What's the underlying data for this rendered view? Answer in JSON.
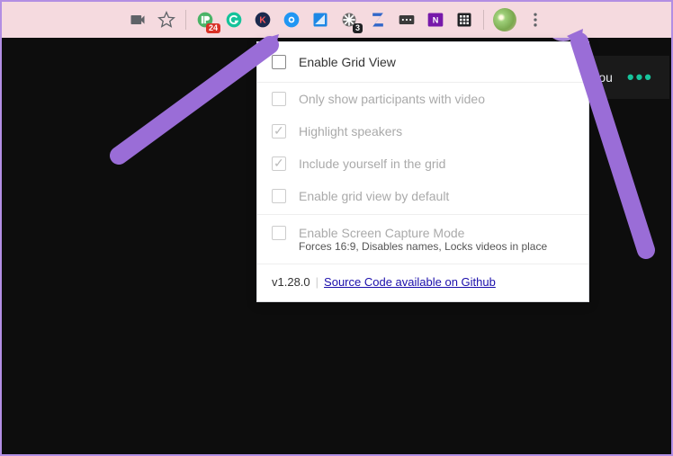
{
  "toolbar": {
    "badge_pushbullet": "24",
    "badge_loom": "3"
  },
  "popup": {
    "options": {
      "enable_grid": "Enable Grid View",
      "only_video": "Only show participants with video",
      "highlight_speakers": "Highlight speakers",
      "include_self": "Include yourself in the grid",
      "enable_default": "Enable grid view by default",
      "screen_capture": "Enable Screen Capture Mode",
      "screen_capture_sub": "Forces 16:9, Disables names, Locks videos in place"
    },
    "version": "v1.28.0",
    "link_text": "Source Code available on Github"
  },
  "meet": {
    "you_label": "ou"
  }
}
